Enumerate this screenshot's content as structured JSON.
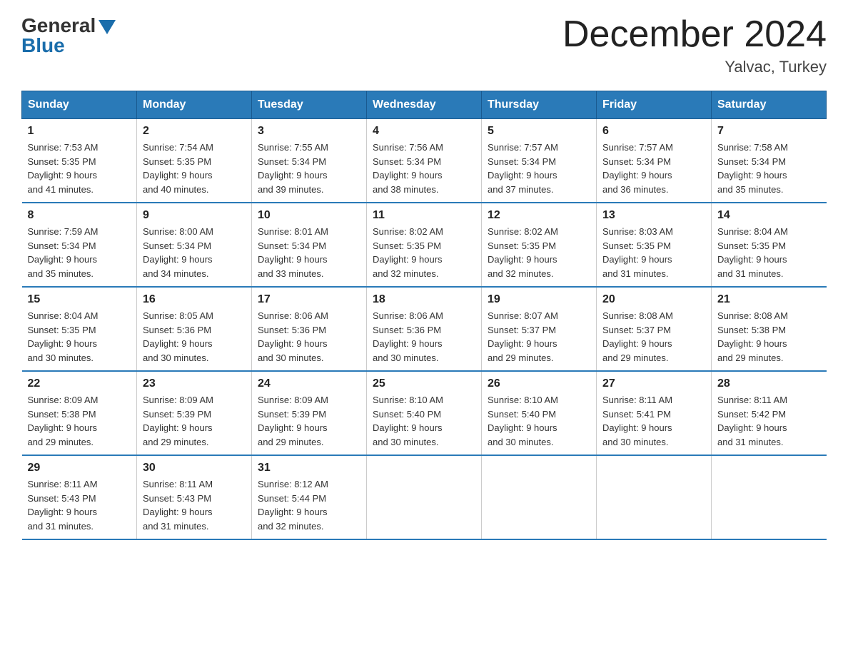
{
  "logo": {
    "general": "General",
    "blue": "Blue"
  },
  "title": "December 2024",
  "location": "Yalvac, Turkey",
  "days_header": [
    "Sunday",
    "Monday",
    "Tuesday",
    "Wednesday",
    "Thursday",
    "Friday",
    "Saturday"
  ],
  "weeks": [
    [
      {
        "day": "1",
        "sunrise": "7:53 AM",
        "sunset": "5:35 PM",
        "daylight": "9 hours and 41 minutes."
      },
      {
        "day": "2",
        "sunrise": "7:54 AM",
        "sunset": "5:35 PM",
        "daylight": "9 hours and 40 minutes."
      },
      {
        "day": "3",
        "sunrise": "7:55 AM",
        "sunset": "5:34 PM",
        "daylight": "9 hours and 39 minutes."
      },
      {
        "day": "4",
        "sunrise": "7:56 AM",
        "sunset": "5:34 PM",
        "daylight": "9 hours and 38 minutes."
      },
      {
        "day": "5",
        "sunrise": "7:57 AM",
        "sunset": "5:34 PM",
        "daylight": "9 hours and 37 minutes."
      },
      {
        "day": "6",
        "sunrise": "7:57 AM",
        "sunset": "5:34 PM",
        "daylight": "9 hours and 36 minutes."
      },
      {
        "day": "7",
        "sunrise": "7:58 AM",
        "sunset": "5:34 PM",
        "daylight": "9 hours and 35 minutes."
      }
    ],
    [
      {
        "day": "8",
        "sunrise": "7:59 AM",
        "sunset": "5:34 PM",
        "daylight": "9 hours and 35 minutes."
      },
      {
        "day": "9",
        "sunrise": "8:00 AM",
        "sunset": "5:34 PM",
        "daylight": "9 hours and 34 minutes."
      },
      {
        "day": "10",
        "sunrise": "8:01 AM",
        "sunset": "5:34 PM",
        "daylight": "9 hours and 33 minutes."
      },
      {
        "day": "11",
        "sunrise": "8:02 AM",
        "sunset": "5:35 PM",
        "daylight": "9 hours and 32 minutes."
      },
      {
        "day": "12",
        "sunrise": "8:02 AM",
        "sunset": "5:35 PM",
        "daylight": "9 hours and 32 minutes."
      },
      {
        "day": "13",
        "sunrise": "8:03 AM",
        "sunset": "5:35 PM",
        "daylight": "9 hours and 31 minutes."
      },
      {
        "day": "14",
        "sunrise": "8:04 AM",
        "sunset": "5:35 PM",
        "daylight": "9 hours and 31 minutes."
      }
    ],
    [
      {
        "day": "15",
        "sunrise": "8:04 AM",
        "sunset": "5:35 PM",
        "daylight": "9 hours and 30 minutes."
      },
      {
        "day": "16",
        "sunrise": "8:05 AM",
        "sunset": "5:36 PM",
        "daylight": "9 hours and 30 minutes."
      },
      {
        "day": "17",
        "sunrise": "8:06 AM",
        "sunset": "5:36 PM",
        "daylight": "9 hours and 30 minutes."
      },
      {
        "day": "18",
        "sunrise": "8:06 AM",
        "sunset": "5:36 PM",
        "daylight": "9 hours and 30 minutes."
      },
      {
        "day": "19",
        "sunrise": "8:07 AM",
        "sunset": "5:37 PM",
        "daylight": "9 hours and 29 minutes."
      },
      {
        "day": "20",
        "sunrise": "8:08 AM",
        "sunset": "5:37 PM",
        "daylight": "9 hours and 29 minutes."
      },
      {
        "day": "21",
        "sunrise": "8:08 AM",
        "sunset": "5:38 PM",
        "daylight": "9 hours and 29 minutes."
      }
    ],
    [
      {
        "day": "22",
        "sunrise": "8:09 AM",
        "sunset": "5:38 PM",
        "daylight": "9 hours and 29 minutes."
      },
      {
        "day": "23",
        "sunrise": "8:09 AM",
        "sunset": "5:39 PM",
        "daylight": "9 hours and 29 minutes."
      },
      {
        "day": "24",
        "sunrise": "8:09 AM",
        "sunset": "5:39 PM",
        "daylight": "9 hours and 29 minutes."
      },
      {
        "day": "25",
        "sunrise": "8:10 AM",
        "sunset": "5:40 PM",
        "daylight": "9 hours and 30 minutes."
      },
      {
        "day": "26",
        "sunrise": "8:10 AM",
        "sunset": "5:40 PM",
        "daylight": "9 hours and 30 minutes."
      },
      {
        "day": "27",
        "sunrise": "8:11 AM",
        "sunset": "5:41 PM",
        "daylight": "9 hours and 30 minutes."
      },
      {
        "day": "28",
        "sunrise": "8:11 AM",
        "sunset": "5:42 PM",
        "daylight": "9 hours and 31 minutes."
      }
    ],
    [
      {
        "day": "29",
        "sunrise": "8:11 AM",
        "sunset": "5:43 PM",
        "daylight": "9 hours and 31 minutes."
      },
      {
        "day": "30",
        "sunrise": "8:11 AM",
        "sunset": "5:43 PM",
        "daylight": "9 hours and 31 minutes."
      },
      {
        "day": "31",
        "sunrise": "8:12 AM",
        "sunset": "5:44 PM",
        "daylight": "9 hours and 32 minutes."
      },
      null,
      null,
      null,
      null
    ]
  ],
  "labels": {
    "sunrise": "Sunrise:",
    "sunset": "Sunset:",
    "daylight": "Daylight:"
  }
}
